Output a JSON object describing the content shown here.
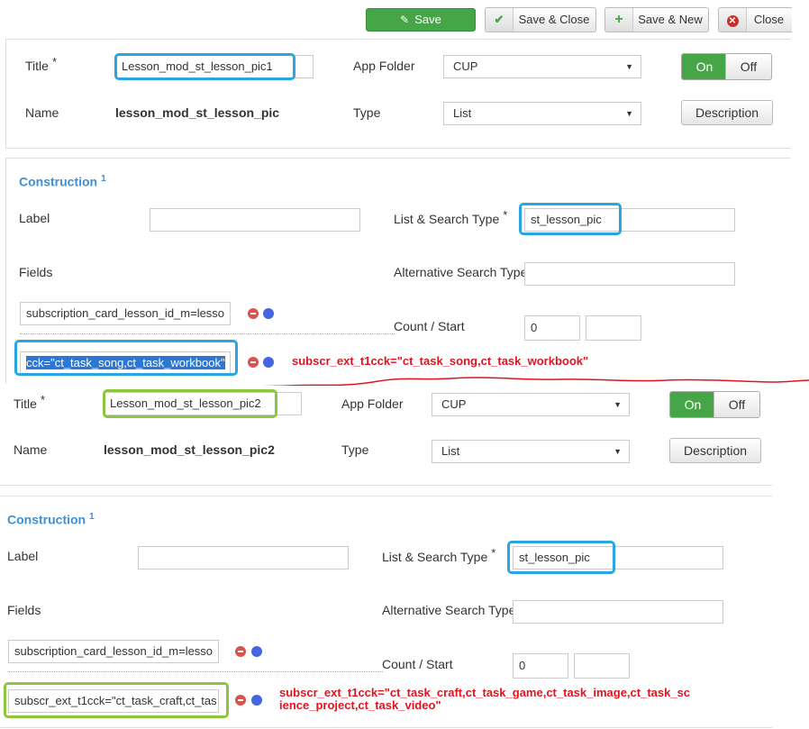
{
  "toolbar": {
    "save_label": "Save",
    "save_close_label": "Save & Close",
    "save_new_label": "Save & New",
    "close_label": "Close"
  },
  "form1": {
    "title_label": "Title",
    "title_value": "Lesson_mod_st_lesson_pic1",
    "name_label": "Name",
    "name_value": "lesson_mod_st_lesson_pic",
    "app_folder_label": "App Folder",
    "app_folder_value": "CUP",
    "type_label": "Type",
    "type_value": "List",
    "on_label": "On",
    "off_label": "Off",
    "description_label": "Description",
    "construction_label": "Construction",
    "construction_sup": "1",
    "label_label": "Label",
    "label_value": "",
    "list_search_label": "List & Search Type",
    "list_search_value": "st_lesson_pic",
    "fields_label": "Fields",
    "alt_search_label": "Alternative Search Type",
    "alt_search_value": "",
    "count_start_label": "Count / Start",
    "count_value": "0",
    "start_value": "",
    "field1_value": "subscription_card_lesson_id_m=lesso",
    "field2_value": "cck=\"ct_task_song,ct_task_workbook\"",
    "annotation": "subscr_ext_t1cck=\"ct_task_song,ct_task_workbook\""
  },
  "form2": {
    "title_label": "Title",
    "title_value": "Lesson_mod_st_lesson_pic2",
    "name_label": "Name",
    "name_value": "lesson_mod_st_lesson_pic2",
    "app_folder_label": "App Folder",
    "app_folder_value": "CUP",
    "type_label": "Type",
    "type_value": "List",
    "on_label": "On",
    "off_label": "Off",
    "description_label": "Description",
    "construction_label": "Construction",
    "construction_sup": "1",
    "label_label": "Label",
    "label_value": "",
    "list_search_label": "List & Search Type",
    "list_search_value": "st_lesson_pic",
    "fields_label": "Fields",
    "alt_search_label": "Alternative Search Type",
    "alt_search_value": "",
    "count_start_label": "Count / Start",
    "count_value": "0",
    "start_value": "",
    "field1_value": "subscription_card_lesson_id_m=lesso",
    "field2_value": "subscr_ext_t1cck=\"ct_task_craft,ct_tas",
    "annotation_line1": "subscr_ext_t1cck=\"ct_task_craft,ct_task_game,ct_task_image,ct_task_sc",
    "annotation_line2": "ience_project,ct_task_video\""
  },
  "colors": {
    "save_green": "#46a546",
    "highlight_blue": "#29a6e0",
    "highlight_green": "#8cc63f",
    "annotation_red": "#e0141e",
    "section_blue": "#3f8fd2"
  },
  "icons": {
    "save": "edit-icon",
    "save_close": "check-icon",
    "save_new": "plus-icon",
    "close": "close-circle-icon"
  }
}
